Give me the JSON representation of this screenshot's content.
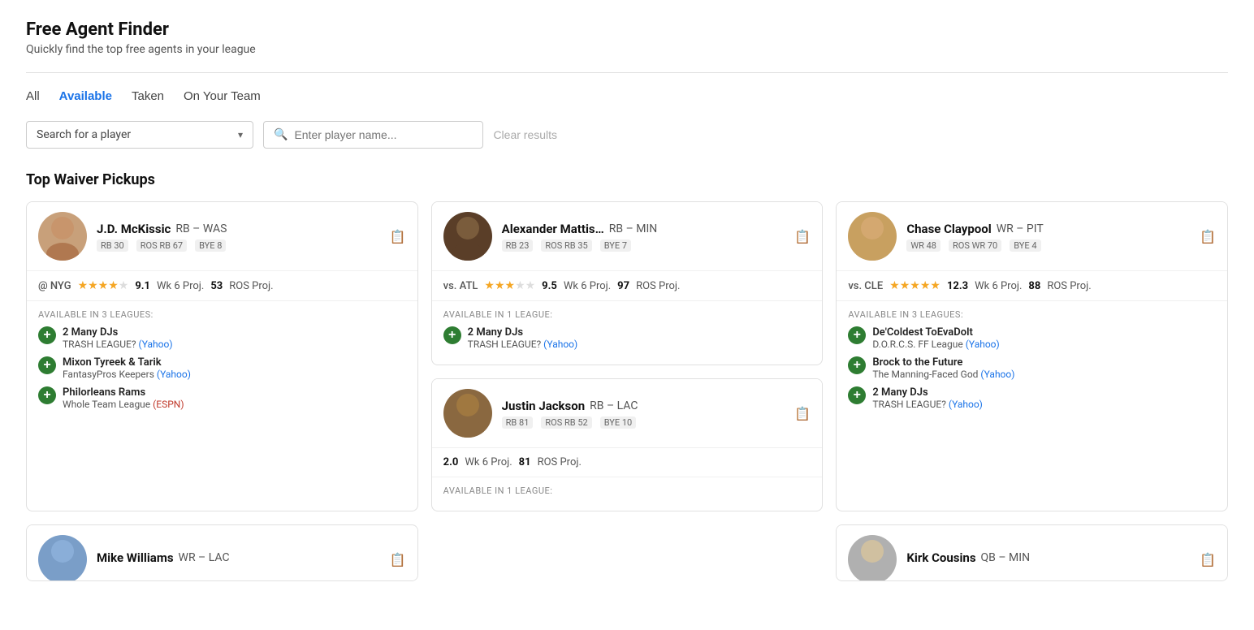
{
  "header": {
    "title": "Free Agent Finder",
    "subtitle": "Quickly find the top free agents in your league"
  },
  "filter_tabs": [
    {
      "label": "All",
      "active": false
    },
    {
      "label": "Available",
      "active": true
    },
    {
      "label": "Taken",
      "active": false
    },
    {
      "label": "On Your Team",
      "active": false
    }
  ],
  "search": {
    "dropdown_placeholder": "Search for a player",
    "input_placeholder": "Enter player name...",
    "clear_label": "Clear results"
  },
  "section_title": "Top Waiver Pickups",
  "players": [
    {
      "id": "jd-mckissic",
      "name": "J.D. McKissic",
      "name_short": "J.D. McKissic",
      "position": "RB",
      "team": "WAS",
      "badges": [
        "RB 30",
        "ROS RB 67",
        "BYE 8"
      ],
      "matchup": "@ NYG",
      "stars": 4,
      "stars_total": 5,
      "wk_proj": "9.1",
      "wk_proj_label": "Wk 6 Proj.",
      "ros_proj": "53",
      "ros_proj_label": "ROS Proj.",
      "available_label": "AVAILABLE IN 3 LEAGUES:",
      "leagues": [
        {
          "name": "2 Many DJs",
          "sub": "TRASH LEAGUE?",
          "link_text": "Yahoo",
          "link_type": "yahoo"
        },
        {
          "name": "Mixon Tyreek & Tarik",
          "sub": "FantasyPros Keepers",
          "link_text": "Yahoo",
          "link_type": "yahoo"
        },
        {
          "name": "Philorleans Rams",
          "sub": "Whole Team League",
          "link_text": "ESPN",
          "link_type": "espn"
        }
      ],
      "avatar_emoji": "🏈"
    },
    {
      "id": "alexander-mattis",
      "name": "Alexander Mattis…",
      "name_short": "Alexander Mattis...",
      "position": "RB",
      "team": "MIN",
      "badges": [
        "RB 23",
        "ROS RB 35",
        "BYE 7"
      ],
      "matchup": "vs. ATL",
      "stars": 3,
      "stars_total": 5,
      "wk_proj": "9.5",
      "wk_proj_label": "Wk 6 Proj.",
      "ros_proj": "97",
      "ros_proj_label": "ROS Proj.",
      "available_label": "AVAILABLE IN 1 LEAGUE:",
      "leagues": [
        {
          "name": "2 Many DJs",
          "sub": "TRASH LEAGUE?",
          "link_text": "Yahoo",
          "link_type": "yahoo"
        }
      ],
      "avatar_emoji": "🏈"
    },
    {
      "id": "chase-claypool",
      "name": "Chase Claypool",
      "name_short": "Chase Claypool",
      "position": "WR",
      "team": "PIT",
      "badges": [
        "WR 48",
        "ROS WR 70",
        "BYE 4"
      ],
      "matchup": "vs. CLE",
      "stars": 5,
      "stars_total": 5,
      "wk_proj": "12.3",
      "wk_proj_label": "Wk 6 Proj.",
      "ros_proj": "88",
      "ros_proj_label": "ROS Proj.",
      "available_label": "AVAILABLE IN 3 LEAGUES:",
      "leagues": [
        {
          "name": "De'Coldest ToEvaDolt",
          "sub": "D.O.R.C.S. FF League",
          "link_text": "Yahoo",
          "link_type": "yahoo"
        },
        {
          "name": "Brock to the Future",
          "sub": "The Manning-Faced God",
          "link_text": "Yahoo",
          "link_type": "yahoo"
        },
        {
          "name": "2 Many DJs",
          "sub": "TRASH LEAGUE?",
          "link_text": "Yahoo",
          "link_type": "yahoo"
        }
      ],
      "avatar_emoji": "🏈"
    },
    {
      "id": "justin-jackson",
      "name": "Justin Jackson",
      "name_short": "Justin Jackson",
      "position": "RB",
      "team": "LAC",
      "badges": [
        "RB 81",
        "ROS RB 52",
        "BYE 10"
      ],
      "matchup": "",
      "stars": 0,
      "stars_total": 5,
      "wk_proj": "2.0",
      "wk_proj_label": "Wk 6 Proj.",
      "ros_proj": "81",
      "ros_proj_label": "ROS Proj.",
      "available_label": "AVAILABLE IN 1 LEAGUE:",
      "leagues": [],
      "avatar_emoji": "🏈"
    },
    {
      "id": "mike-williams",
      "name": "Mike Williams",
      "name_short": "Mike Williams",
      "position": "WR",
      "team": "LAC",
      "badges": [],
      "matchup": "",
      "stars": 0,
      "stars_total": 5,
      "wk_proj": "",
      "wk_proj_label": "",
      "ros_proj": "",
      "ros_proj_label": "",
      "available_label": "",
      "leagues": [],
      "avatar_emoji": "🏈"
    },
    {
      "id": "kirk-cousins",
      "name": "Kirk Cousins",
      "name_short": "Kirk Cousins",
      "position": "QB",
      "team": "MIN",
      "badges": [],
      "matchup": "",
      "stars": 0,
      "stars_total": 5,
      "wk_proj": "",
      "wk_proj_label": "",
      "ros_proj": "",
      "ros_proj_label": "",
      "available_label": "",
      "leagues": [],
      "avatar_emoji": "🏈"
    }
  ]
}
